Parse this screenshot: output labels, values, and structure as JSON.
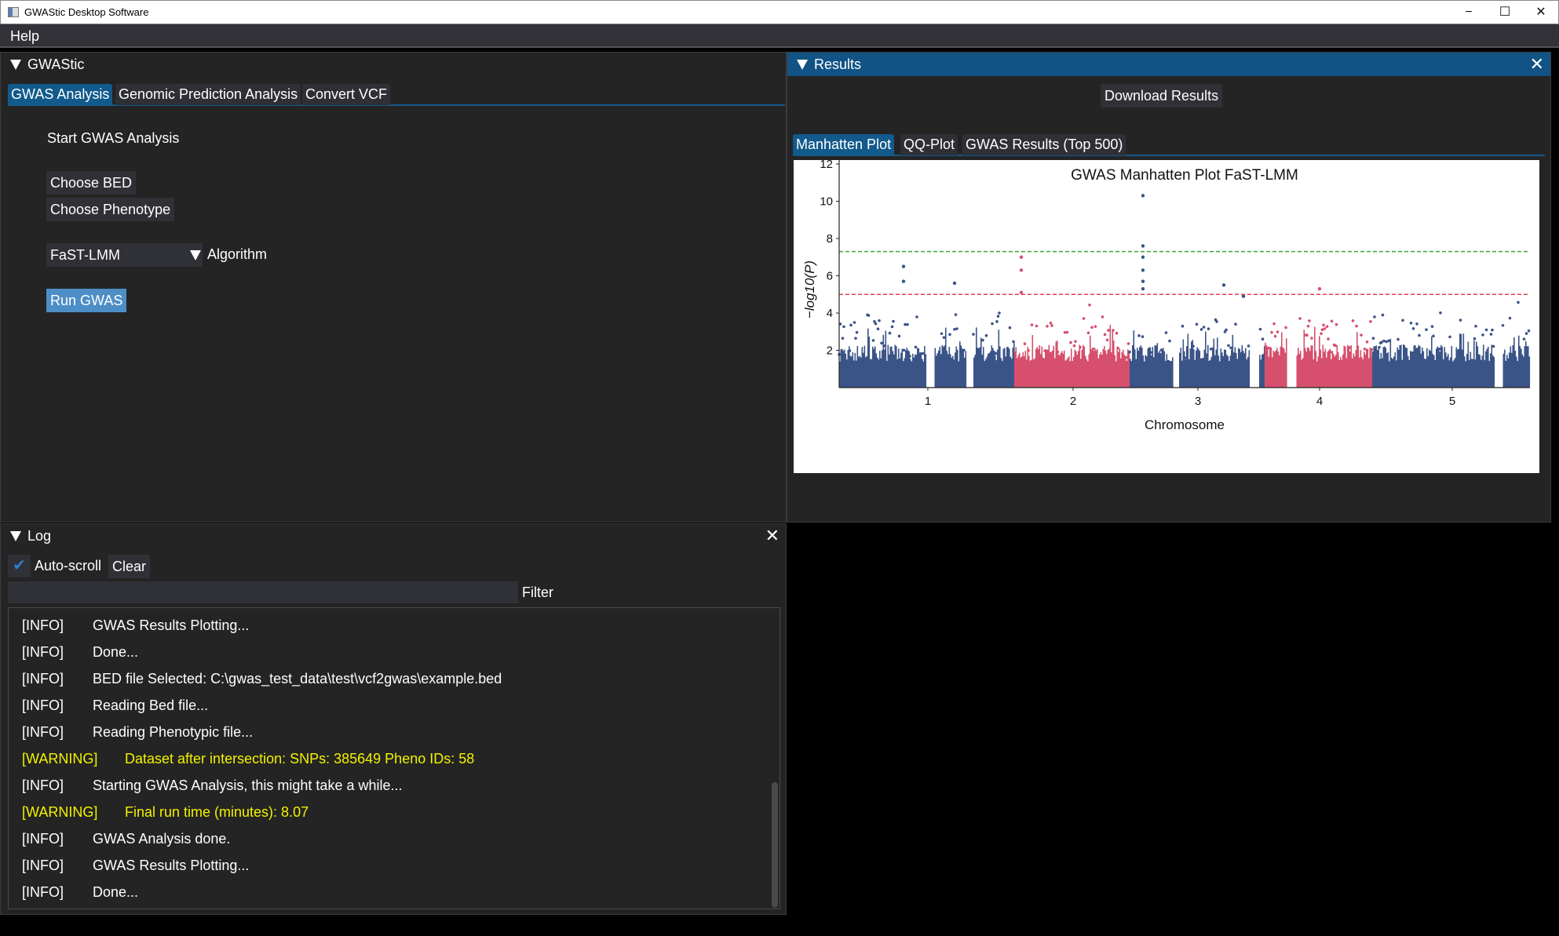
{
  "window": {
    "title": "GWAStic Desktop Software",
    "minimize": "−",
    "maximize": "☐",
    "close": "✕"
  },
  "menu": {
    "items": [
      {
        "label": "Help"
      }
    ]
  },
  "gwastic_panel": {
    "title": "GWAStic",
    "tabs": [
      {
        "label": "GWAS Analysis",
        "active": true
      },
      {
        "label": "Genomic Prediction Analysis",
        "active": false
      },
      {
        "label": "Convert VCF",
        "active": false
      }
    ],
    "section_title": "Start GWAS Analysis",
    "choose_bed": "Choose BED",
    "choose_phenotype": "Choose Phenotype",
    "algorithm_value": "FaST-LMM",
    "algorithm_label": "Algorithm",
    "run_button": "Run GWAS",
    "accent": "#125a8c",
    "run_color": "#4d8ec7"
  },
  "results_panel": {
    "title": "Results",
    "download": "Download Results",
    "tabs": [
      {
        "label": "Manhatten Plot",
        "active": true
      },
      {
        "label": "QQ-Plot",
        "active": false
      },
      {
        "label": "GWAS Results (Top 500)",
        "active": false
      }
    ]
  },
  "chart_data": {
    "type": "scatter",
    "title": "GWAS Manhatten Plot FaST-LMM",
    "xlabel": "Chromosome",
    "ylabel": "−log10(P)",
    "categories": [
      "1",
      "2",
      "3",
      "4",
      "5"
    ],
    "yticks": [
      "2",
      "4",
      "6",
      "8",
      "10",
      "12"
    ],
    "ylim": [
      0,
      12.3
    ],
    "colors": [
      "#3b5488",
      "#d6506e"
    ],
    "thresholds": [
      {
        "value": 7.3,
        "color": "#3aa63a",
        "style": "dashed"
      },
      {
        "value": 5.0,
        "color": "#e0404f",
        "style": "dashed"
      }
    ],
    "top_points": [
      {
        "chromosome": "3",
        "y": 10.3
      },
      {
        "chromosome": "3",
        "y": 7.6
      },
      {
        "chromosome": "3",
        "y": 7.0
      },
      {
        "chromosome": "3",
        "y": 6.3
      },
      {
        "chromosome": "3",
        "y": 5.7
      },
      {
        "chromosome": "3",
        "y": 5.3
      },
      {
        "chromosome": "2",
        "y": 7.0
      },
      {
        "chromosome": "2",
        "y": 6.3
      },
      {
        "chromosome": "2",
        "y": 5.1
      },
      {
        "chromosome": "1",
        "y": 6.5
      },
      {
        "chromosome": "1",
        "y": 5.7
      },
      {
        "chromosome": "1",
        "y": 5.6
      },
      {
        "chromosome": "3",
        "y": 5.5
      },
      {
        "chromosome": "4",
        "y": 5.3
      },
      {
        "chromosome": "3",
        "y": 4.9
      }
    ],
    "grid": false,
    "legend": "none"
  },
  "log_panel": {
    "title": "Log",
    "autoscroll_label": "Auto-scroll",
    "autoscroll_checked": true,
    "clear": "Clear",
    "filter_value": "",
    "filter_label": "Filter",
    "lines": [
      {
        "tag": "[INFO]",
        "msg": "GWAS Results Plotting..."
      },
      {
        "tag": "[INFO]",
        "msg": "Done..."
      },
      {
        "tag": "[INFO]",
        "msg": "BED file Selected: C:\\gwas_test_data\\test\\vcf2gwas\\example.bed"
      },
      {
        "tag": "[INFO]",
        "msg": "Reading Bed file..."
      },
      {
        "tag": "[INFO]",
        "msg": "Reading Phenotypic file..."
      },
      {
        "tag": "[WARNING]",
        "msg": "Dataset after intersection: SNPs: 385649 Pheno IDs: 58"
      },
      {
        "tag": "[INFO]",
        "msg": "Starting GWAS Analysis, this might take a while..."
      },
      {
        "tag": "[WARNING]",
        "msg": "Final run time (minutes): 8.07"
      },
      {
        "tag": "[INFO]",
        "msg": "GWAS Analysis done."
      },
      {
        "tag": "[INFO]",
        "msg": "GWAS Results Plotting..."
      },
      {
        "tag": "[INFO]",
        "msg": "Done..."
      }
    ],
    "warning_color": "#f2f200"
  }
}
